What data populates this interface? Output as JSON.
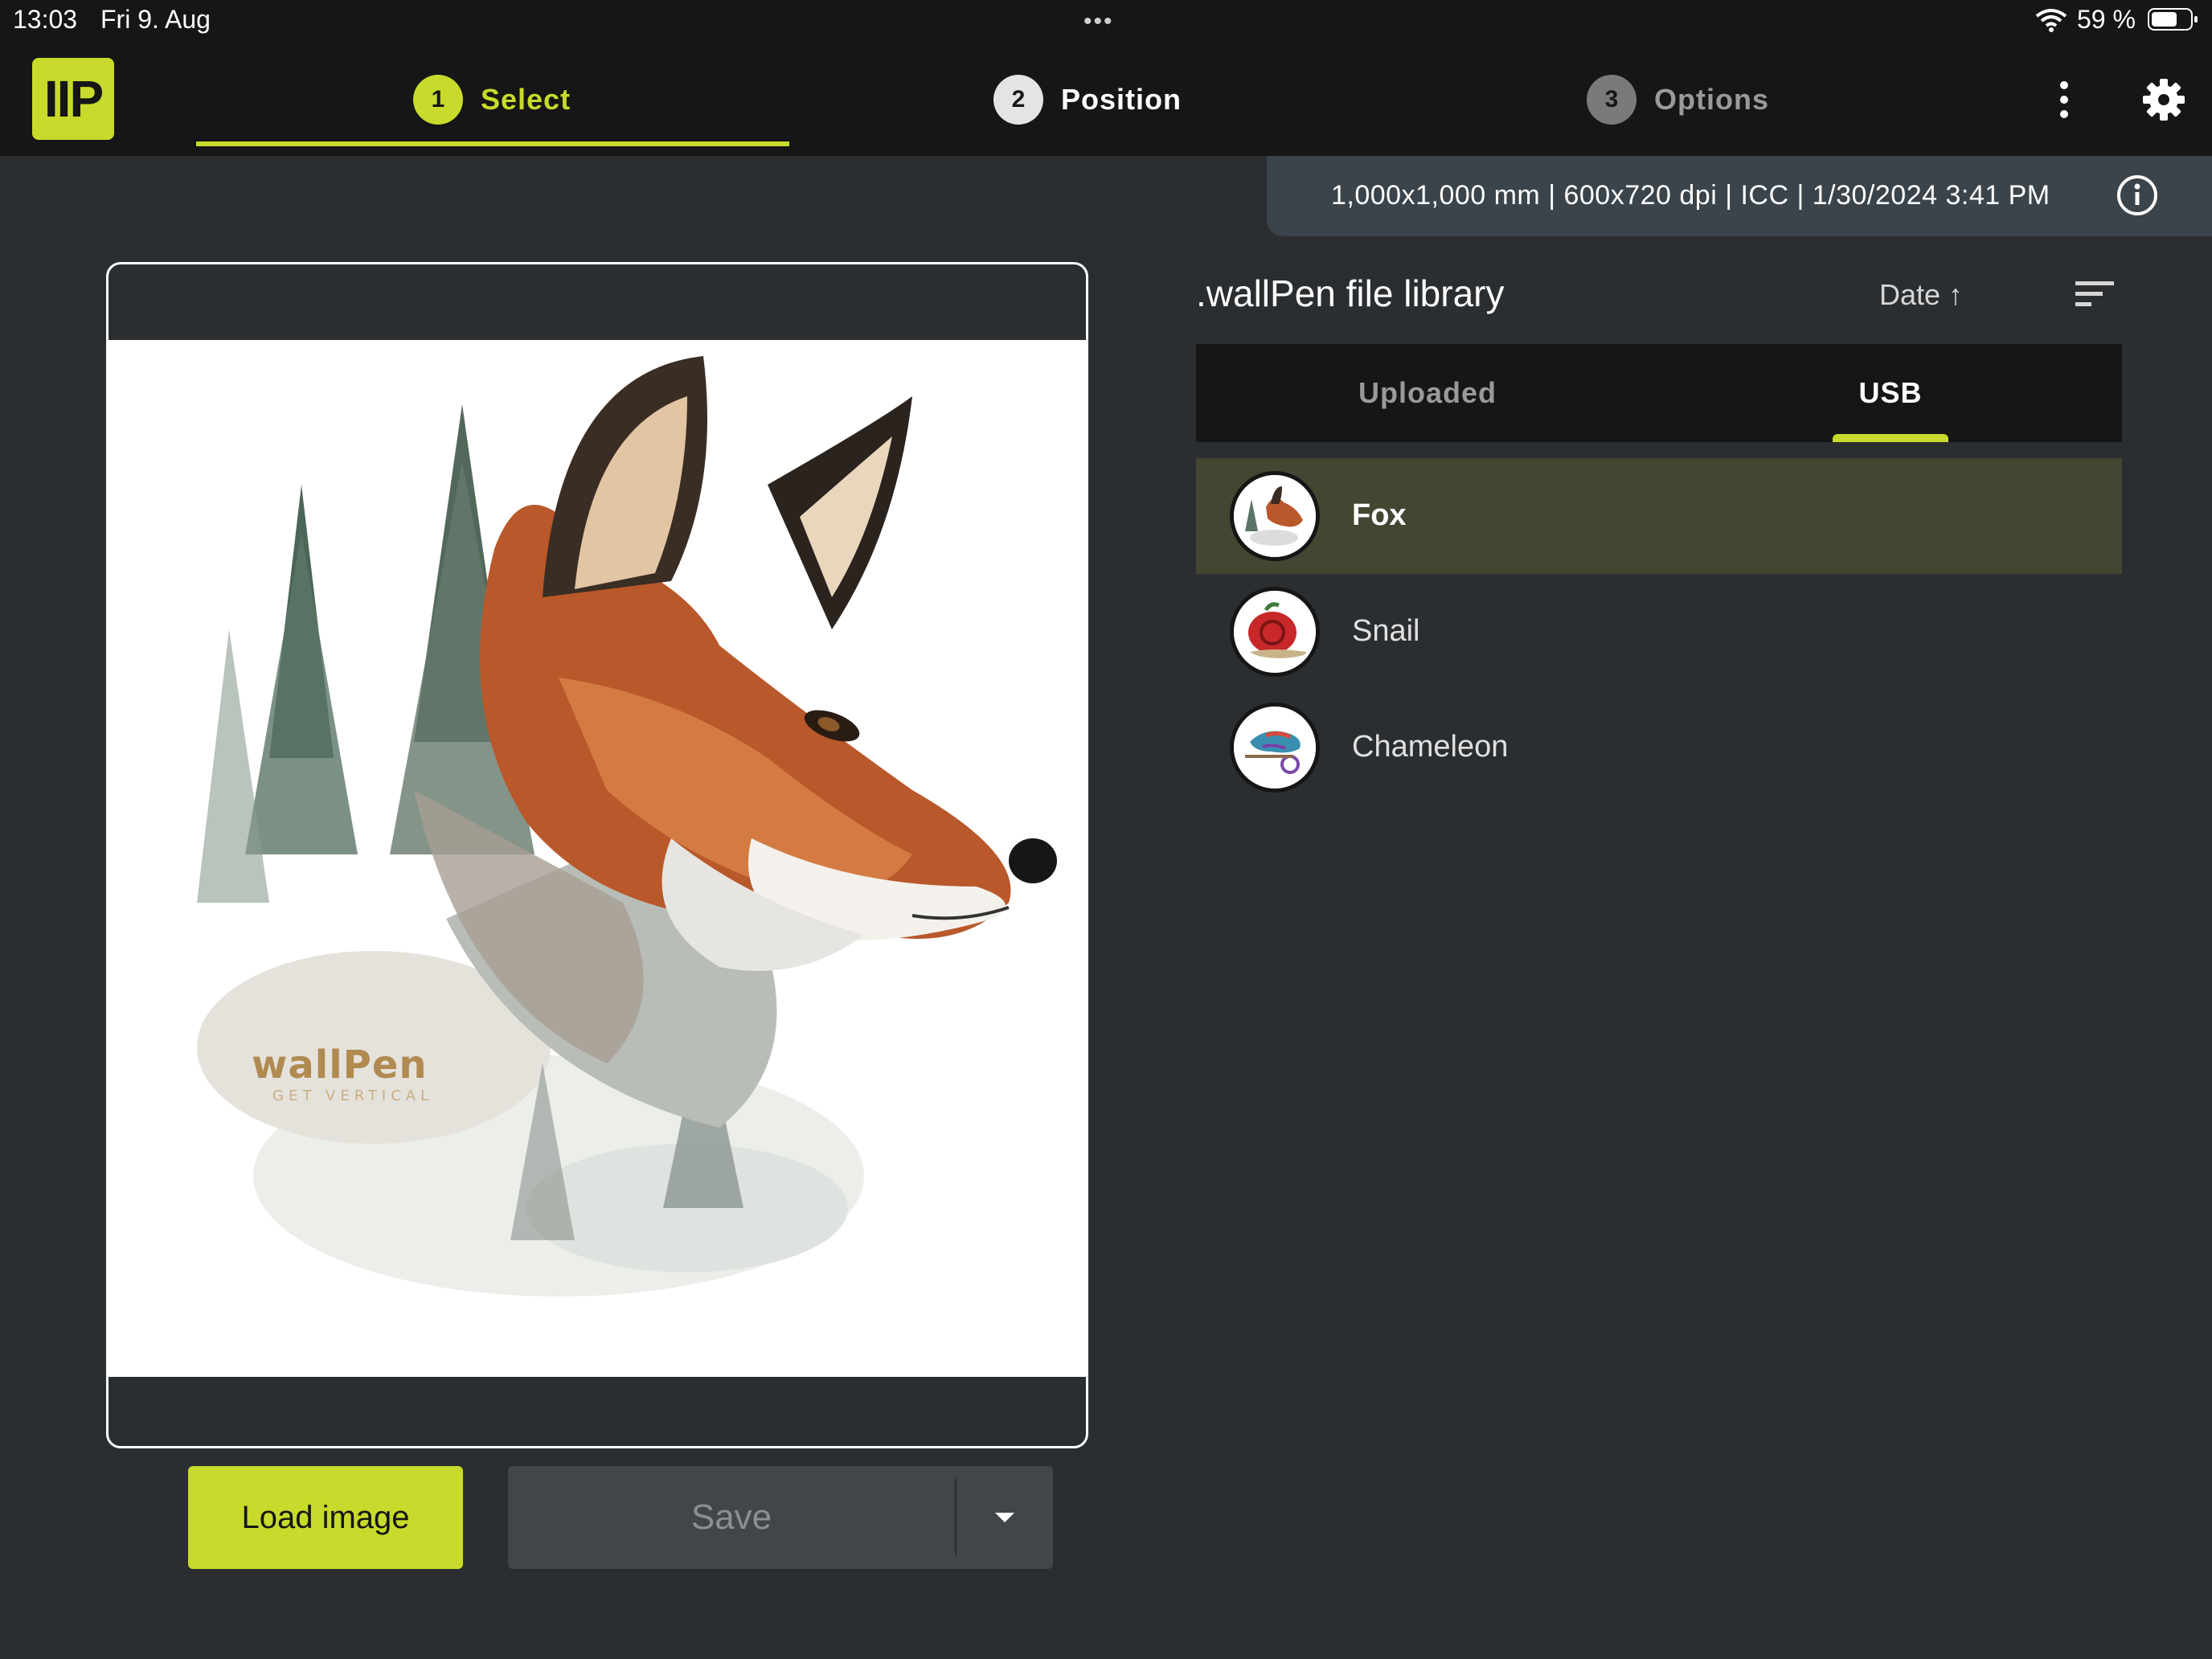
{
  "status_bar": {
    "time": "13:03",
    "date": "Fri 9. Aug",
    "battery": "59 %",
    "battery_level": 0.59
  },
  "app": {
    "logo_text": "IIP",
    "accent_color": "#c8da2b"
  },
  "steps": [
    {
      "number": "1",
      "label": "Select",
      "state": "active"
    },
    {
      "number": "2",
      "label": "Position",
      "state": "enabled"
    },
    {
      "number": "3",
      "label": "Options",
      "state": "disabled"
    }
  ],
  "toolbar": {
    "more_icon": "more-vertical-icon",
    "settings_icon": "gear-icon"
  },
  "file_info": {
    "text": "1,000x1,000 mm | 600x720 dpi | ICC | 1/30/2024 3:41 PM",
    "icon": "info-icon"
  },
  "preview": {
    "watermark_brand": "wallPen",
    "watermark_tagline": "GET VERTICAL"
  },
  "actions": {
    "load_label": "Load image",
    "save_label": "Save",
    "save_dropdown_icon": "caret-down-icon"
  },
  "library": {
    "title": ".wallPen file library",
    "sort_label": "Date ↑",
    "filter_icon": "sort-lines-icon",
    "tabs": [
      {
        "label": "Uploaded",
        "active": false
      },
      {
        "label": "USB",
        "active": true
      }
    ],
    "files": [
      {
        "name": "Fox",
        "selected": true
      },
      {
        "name": "Snail",
        "selected": false
      },
      {
        "name": "Chameleon",
        "selected": false
      }
    ]
  }
}
